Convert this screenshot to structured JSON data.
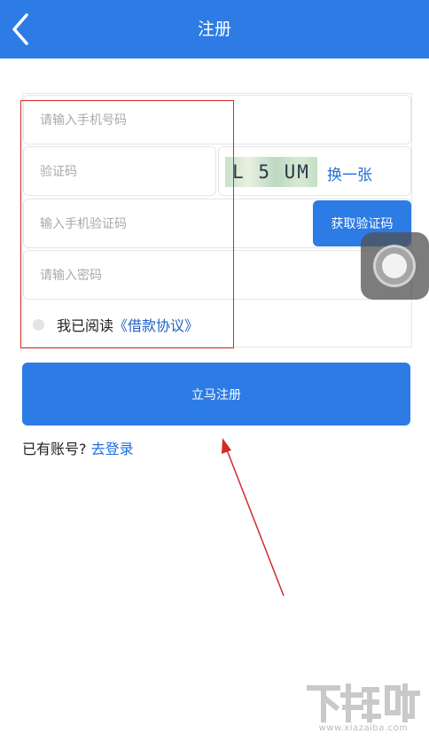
{
  "header": {
    "title": "注册",
    "back_icon": "chevron-left-icon"
  },
  "form": {
    "phone_placeholder": "请输入手机号码",
    "captcha_placeholder": "验证码",
    "captcha_text": "L 5 UM",
    "captcha_refresh_label": "换一张",
    "sms_code_placeholder": "输入手机验证码",
    "get_sms_code_label": "获取验证码",
    "password_placeholder": "请输入密码",
    "agreement_prefix": "我已阅读",
    "agreement_link": "《借款协议》"
  },
  "submit_label": "立马注册",
  "login_prompt": "已有账号?",
  "login_link": "去登录",
  "watermark": {
    "text": "下载吧",
    "url": "www.xiazaiba.com"
  },
  "colors": {
    "primary": "#2d7be5",
    "annotation": "#d22a2a",
    "link": "#1e6fd9"
  }
}
